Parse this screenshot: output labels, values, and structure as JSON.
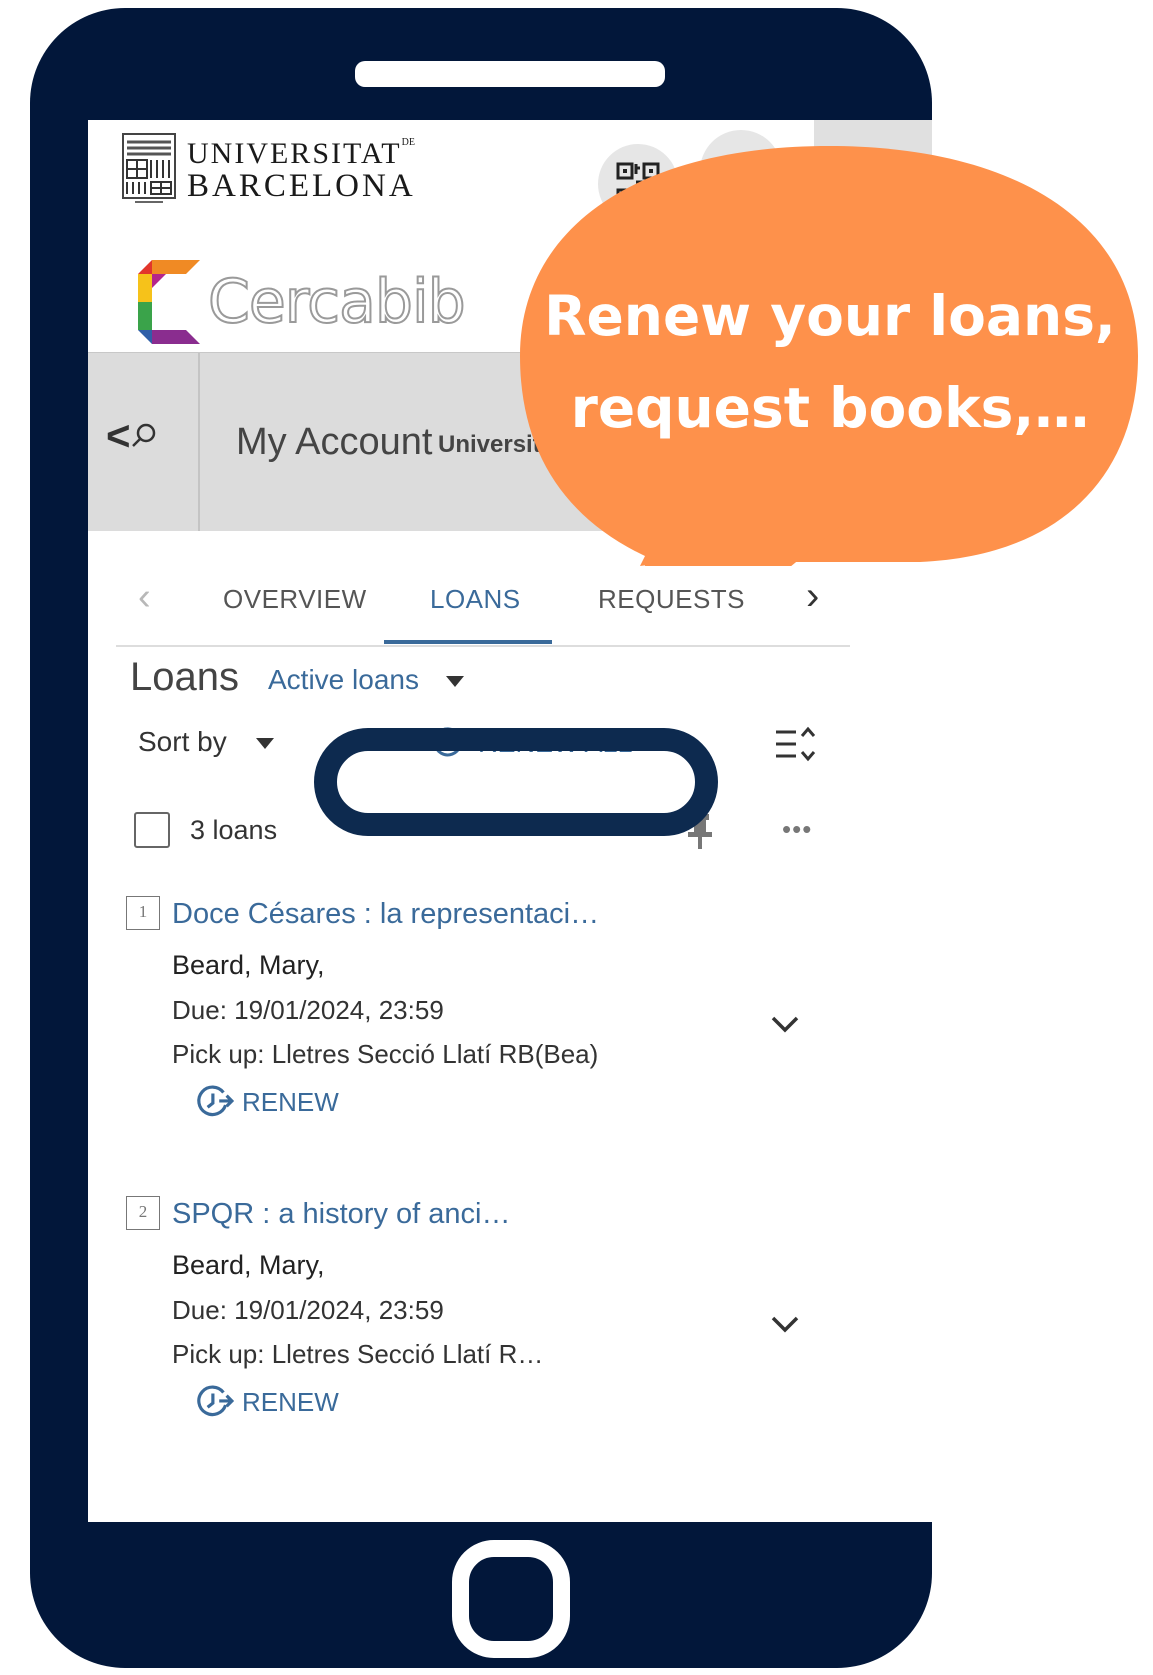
{
  "header": {
    "university_line1": "UNIVERSITAT",
    "university_de": "DE",
    "university_line2": "BARCELONA",
    "app_name": "Cercabib"
  },
  "account_bar": {
    "title": "My Account",
    "institution": "Universita"
  },
  "tabs": [
    {
      "label": "OVERVIEW",
      "active": false
    },
    {
      "label": "LOANS",
      "active": true
    },
    {
      "label": "REQUESTS",
      "active": false
    }
  ],
  "loans": {
    "title": "Loans",
    "filter": "Active loans",
    "sort_label": "Sort by",
    "renew_all_label": "RENEW ALL",
    "count_label": "3 loans",
    "more_label": "•••",
    "items": [
      {
        "num": "1",
        "title": "Doce Césares : la representaci…",
        "author": "Beard, Mary,",
        "due": "Due: 19/01/2024, 23:59",
        "pickup": "Pick up: Lletres Secció Llatí RB(Bea)",
        "renew_label": "RENEW"
      },
      {
        "num": "2",
        "title": "SPQR : a history of anci…",
        "author": "Beard, Mary,",
        "due": "Due: 19/01/2024, 23:59",
        "pickup": "Pick up: Lletres Secció Llatí R…",
        "renew_label": "RENEW"
      }
    ]
  },
  "annotation": {
    "bubble_line1": "Renew your loans,",
    "bubble_line2": "request books,…",
    "bubble_color": "#fe914b",
    "ring_color": "#0d2a4f"
  },
  "colors": {
    "phone_frame": "#02173a",
    "accent": "#3a6a9a"
  }
}
